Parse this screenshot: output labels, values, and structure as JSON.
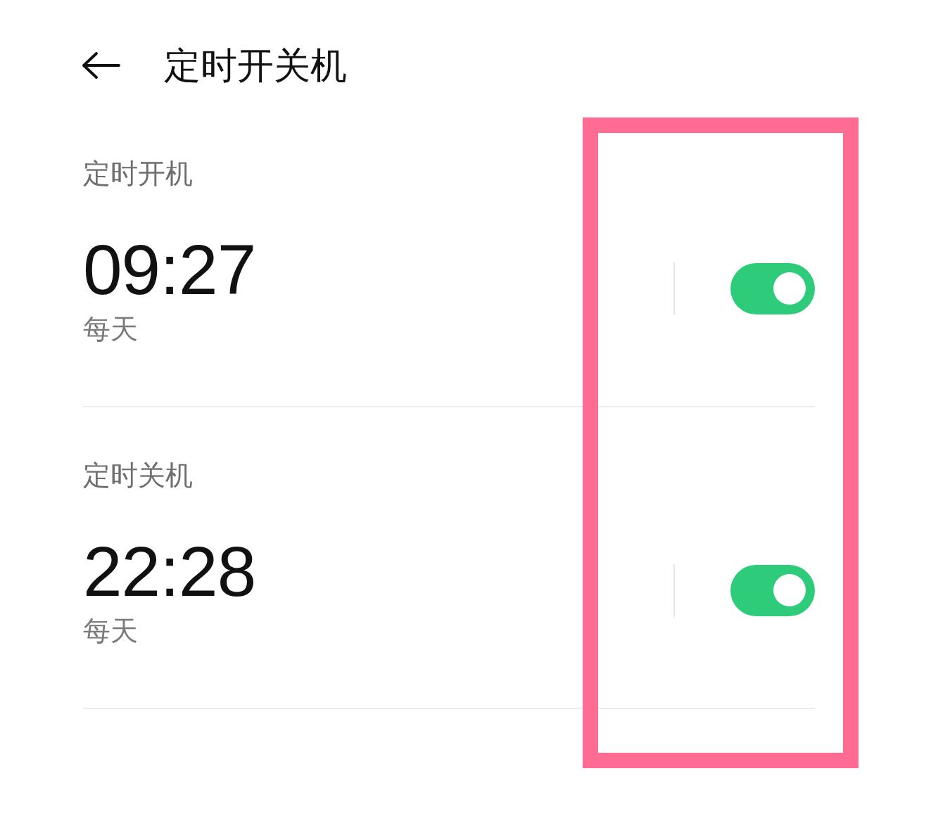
{
  "header": {
    "title": "定时开关机"
  },
  "schedules": [
    {
      "label": "定时开机",
      "time": "09:27",
      "repeat": "每天",
      "on": true
    },
    {
      "label": "定时关机",
      "time": "22:28",
      "repeat": "每天",
      "on": true
    }
  ],
  "annotations": [
    {
      "kind": "highlight-rectangle"
    }
  ]
}
